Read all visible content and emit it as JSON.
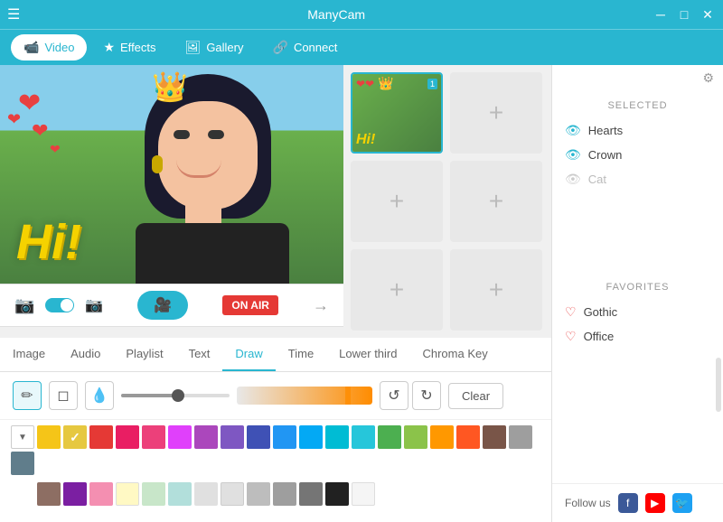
{
  "titleBar": {
    "title": "ManyCam",
    "menuIcon": "☰",
    "minimizeIcon": "─",
    "maximizeIcon": "□",
    "closeIcon": "✕"
  },
  "nav": {
    "items": [
      {
        "id": "video",
        "label": "Video",
        "icon": "📹",
        "active": true
      },
      {
        "id": "effects",
        "label": "Effects",
        "icon": "★"
      },
      {
        "id": "gallery",
        "label": "Gallery",
        "icon": "🖼"
      },
      {
        "id": "connect",
        "label": "Connect",
        "icon": "🔗"
      }
    ]
  },
  "videoOverlay": {
    "hiText": "Hi!",
    "onAirLabel": "ON AIR"
  },
  "controls": {
    "arrowIcon": "→"
  },
  "tabs": [
    {
      "id": "image",
      "label": "Image"
    },
    {
      "id": "audio",
      "label": "Audio"
    },
    {
      "id": "playlist",
      "label": "Playlist"
    },
    {
      "id": "text",
      "label": "Text"
    },
    {
      "id": "draw",
      "label": "Draw",
      "active": true
    },
    {
      "id": "time",
      "label": "Time"
    },
    {
      "id": "lower-third",
      "label": "Lower third"
    },
    {
      "id": "chroma-key",
      "label": "Chroma Key"
    }
  ],
  "drawTools": {
    "penIcon": "✏",
    "eraserIcon": "◻",
    "fillIcon": "💧",
    "undoIcon": "↺",
    "redoIcon": "↻",
    "clearLabel": "Clear"
  },
  "selectedPanel": {
    "label": "SELECTED",
    "items": [
      {
        "id": "hearts",
        "label": "Hearts",
        "visible": true
      },
      {
        "id": "crown",
        "label": "Crown",
        "visible": true
      },
      {
        "id": "cat",
        "label": "Cat",
        "visible": false
      }
    ]
  },
  "favoritesPanel": {
    "label": "FAVORITES",
    "items": [
      {
        "id": "gothic",
        "label": "Gothic"
      },
      {
        "id": "office",
        "label": "Office"
      }
    ]
  },
  "followUs": {
    "label": "Follow us"
  },
  "colors": [
    "#f5c518",
    "#e6c840",
    "#e53935",
    "#e91e63",
    "#f44336",
    "#e040fb",
    "#ab47bc",
    "#7e57c2",
    "#3f51b5",
    "#2196f3",
    "#03a9f4",
    "#00bcd4",
    "#26c6da",
    "#4caf50",
    "#8bc34a",
    "#ff9800",
    "#ff5722",
    "#795548",
    "#9e9e9e",
    "#607d8b",
    "#f5f5dc"
  ],
  "colors2": [
    "#8d6e63",
    "#7b1fa2",
    "#f48fb1",
    "#fff9c4",
    "#c8e6c9",
    "#b2dfdb",
    "#e0e0e0",
    "#bdbdbd",
    "#9e9e9e",
    "#757575",
    "#212121",
    "#f5f5f5"
  ]
}
